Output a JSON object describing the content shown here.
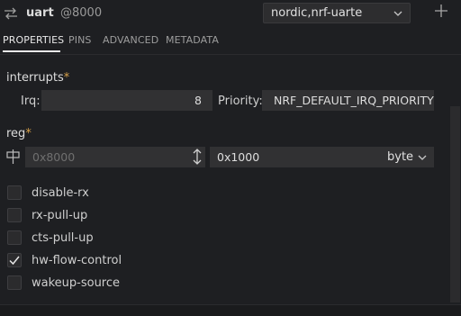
{
  "header": {
    "node_name": "uart",
    "node_address": "@8000",
    "compatible_value": "nordic,nrf-uarte"
  },
  "tabs": [
    {
      "label": "PROPERTIES",
      "active": true
    },
    {
      "label": "PINS",
      "active": false
    },
    {
      "label": "ADVANCED",
      "active": false
    },
    {
      "label": "METADATA",
      "active": false
    }
  ],
  "interrupts": {
    "title": "interrupts",
    "required_mark": "*",
    "irq_label": "Irq:",
    "irq_value": "8",
    "priority_label": "Priority:",
    "priority_value": "NRF_DEFAULT_IRQ_PRIORITY"
  },
  "reg": {
    "title": "reg",
    "required_mark": "*",
    "address_placeholder": "0x8000",
    "size_value": "0x1000",
    "unit_value": "byte"
  },
  "options": [
    {
      "label": "disable-rx",
      "checked": false
    },
    {
      "label": "rx-pull-up",
      "checked": false
    },
    {
      "label": "cts-pull-up",
      "checked": false
    },
    {
      "label": "hw-flow-control",
      "checked": true
    },
    {
      "label": "wakeup-source",
      "checked": false
    }
  ],
  "colors": {
    "background": "#1e1f22",
    "field": "#313133",
    "required": "#d7a14b",
    "text": "#cccccc"
  }
}
